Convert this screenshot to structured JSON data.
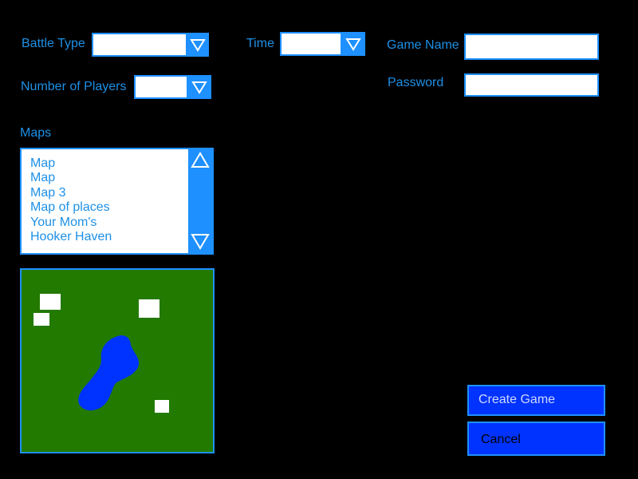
{
  "form": {
    "battle_type": {
      "label": "Battle Type",
      "value": ""
    },
    "number_of_players": {
      "label": "Number of Players",
      "value": ""
    },
    "time": {
      "label": "Time",
      "value": ""
    },
    "game_name": {
      "label": "Game Name",
      "value": ""
    },
    "password": {
      "label": "Password",
      "value": ""
    }
  },
  "maps": {
    "label": "Maps",
    "items": [
      "Map",
      "Map",
      "Map 3",
      "Map of places",
      "Your Mom's",
      "Hooker Haven"
    ]
  },
  "map_preview": {
    "ground_color": "#237a00",
    "water_color": "#0033ff",
    "marker_color": "#ffffff"
  },
  "buttons": {
    "create": "Create Game",
    "cancel": "Cancel"
  },
  "colors": {
    "background": "#000000",
    "accent": "#1e90ff",
    "label_text": "#1e90e6",
    "button_fill": "#0033ff",
    "create_text": "#cfd8ff",
    "cancel_text": "#000000"
  },
  "icons": {
    "dropdown": "triangle-down-icon",
    "scroll_up": "triangle-up-icon",
    "scroll_down": "triangle-down-icon"
  }
}
